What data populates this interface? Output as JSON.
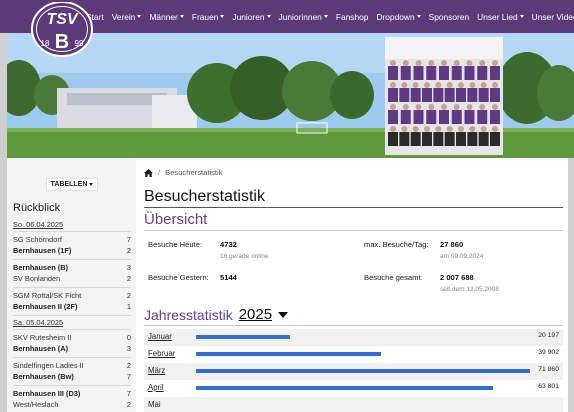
{
  "nav": {
    "items": [
      {
        "label": "Start",
        "dropdown": false
      },
      {
        "label": "Verein",
        "dropdown": true
      },
      {
        "label": "Männer",
        "dropdown": true
      },
      {
        "label": "Frauen",
        "dropdown": true
      },
      {
        "label": "Junioren",
        "dropdown": true
      },
      {
        "label": "Juniorinnen",
        "dropdown": true
      },
      {
        "label": "Fanshop",
        "dropdown": false
      },
      {
        "label": "Dropdown",
        "dropdown": true
      },
      {
        "label": "Sponsoren",
        "dropdown": false
      },
      {
        "label": "Unser Lied",
        "dropdown": true
      },
      {
        "label": "Unser Video",
        "dropdown": false
      }
    ]
  },
  "logo": {
    "line1": "TSV",
    "letter": "B",
    "year_left": "18",
    "year_right": "99"
  },
  "colors": {
    "brand": "#5c3a7a",
    "accent_text": "#6a3f8c",
    "bar": "#2f6fd6"
  },
  "sidebar": {
    "tables_button": "TABELLEN",
    "title": "Rückblick",
    "days": [
      {
        "date": "So. 06.04.2025",
        "matches": [
          {
            "home": "SG Schorndorf",
            "home_score": "7",
            "home_bold": false,
            "away": "Bernhausen (1F)",
            "away_score": "2",
            "away_bold": true
          },
          {
            "home": "Bernhausen (B)",
            "home_score": "3",
            "home_bold": true,
            "away": "SV Bonlanden",
            "away_score": "2",
            "away_bold": false
          },
          {
            "home": "SGM Rottal/SK Ficht",
            "home_score": "2",
            "home_bold": false,
            "away": "Bernhausen II (2F)",
            "away_score": "1",
            "away_bold": true
          }
        ]
      },
      {
        "date": "Sa. 05.04.2025",
        "matches": [
          {
            "home": "SKV Rutesheim II",
            "home_score": "0",
            "home_bold": false,
            "away": "Bernhausen (A)",
            "away_score": "3",
            "away_bold": true
          },
          {
            "home": "Sindelfingen Ladies II",
            "home_score": "2",
            "home_bold": false,
            "away": "Bernhausen (Bw)",
            "away_score": "7",
            "away_bold": true
          },
          {
            "home": "Bernhausen III (D3)",
            "home_score": "7",
            "home_bold": true,
            "away": "West/Heslach",
            "away_score": "2",
            "away_bold": false
          }
        ]
      }
    ]
  },
  "breadcrumb": {
    "current": "Besucherstatistik"
  },
  "page_title": "Besucherstatistik",
  "overview": {
    "title": "Übersicht",
    "today_label": "Besuche Heute:",
    "today_value": "4732",
    "today_sub": "16 gerade online",
    "yesterday_label": "Besuche Gestern:",
    "yesterday_value": "5144",
    "max_label": "max. Besuche/Tag:",
    "max_value": "27 860",
    "max_sub": "am 09.09.2024",
    "total_label": "Besuche gesamt:",
    "total_value": "2 007 688",
    "total_sub": "seit dem 12.05.2008"
  },
  "year_stats": {
    "title": "Jahresstatistik",
    "year": "2025",
    "max": 71860,
    "months": [
      {
        "name": "Januar",
        "value": 20197,
        "display": "20 197"
      },
      {
        "name": "Februar",
        "value": 39902,
        "display": "39 902"
      },
      {
        "name": "März",
        "value": 71860,
        "display": "71 860"
      },
      {
        "name": "April",
        "value": 63801,
        "display": "63 801"
      },
      {
        "name": "Mai",
        "value": null,
        "display": ""
      }
    ]
  }
}
